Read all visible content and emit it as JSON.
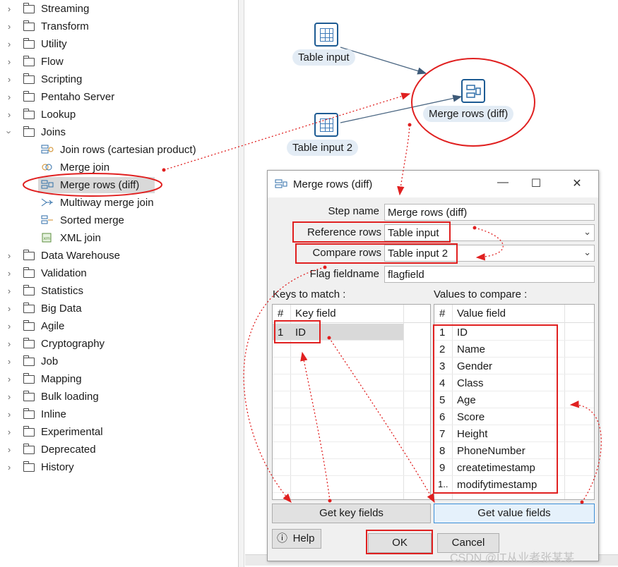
{
  "tree": {
    "categories_top": [
      {
        "label": "Streaming"
      },
      {
        "label": "Transform"
      },
      {
        "label": "Utility"
      },
      {
        "label": "Flow"
      },
      {
        "label": "Scripting"
      },
      {
        "label": "Pentaho Server"
      },
      {
        "label": "Lookup"
      }
    ],
    "joins": {
      "label": "Joins",
      "items": [
        {
          "label": "Join rows (cartesian product)"
        },
        {
          "label": "Merge join"
        },
        {
          "label": "Merge rows (diff)"
        },
        {
          "label": "Multiway merge join"
        },
        {
          "label": "Sorted merge"
        },
        {
          "label": "XML join"
        }
      ]
    },
    "categories_bottom": [
      {
        "label": "Data Warehouse"
      },
      {
        "label": "Validation"
      },
      {
        "label": "Statistics"
      },
      {
        "label": "Big Data"
      },
      {
        "label": "Agile"
      },
      {
        "label": "Cryptography"
      },
      {
        "label": "Job"
      },
      {
        "label": "Mapping"
      },
      {
        "label": "Bulk loading"
      },
      {
        "label": "Inline"
      },
      {
        "label": "Experimental"
      },
      {
        "label": "Deprecated"
      },
      {
        "label": "History"
      }
    ],
    "selected_item": "Merge rows (diff)"
  },
  "canvas": {
    "steps": {
      "table_input": "Table input",
      "table_input_2": "Table input 2",
      "merge_rows": "Merge rows (diff)"
    }
  },
  "dialog": {
    "title": "Merge rows (diff)",
    "step_name_label": "Step name",
    "step_name_value": "Merge rows (diff)",
    "reference_rows_label": "Reference rows",
    "reference_rows_value": "Table input",
    "compare_rows_label": "Compare rows",
    "compare_rows_value": "Table input 2",
    "flag_fieldname_label": "Flag fieldname",
    "flag_fieldname_value": "flagfield",
    "keys_title": "Keys to match :",
    "values_title": "Values to compare :",
    "keys_grid": {
      "col_num": "#",
      "col_field": "Key field",
      "rows": [
        {
          "num": "1",
          "field": "ID"
        }
      ]
    },
    "values_grid": {
      "col_num": "#",
      "col_field": "Value field",
      "rows": [
        {
          "num": "1",
          "field": "ID"
        },
        {
          "num": "2",
          "field": "Name"
        },
        {
          "num": "3",
          "field": "Gender"
        },
        {
          "num": "4",
          "field": "Class"
        },
        {
          "num": "5",
          "field": "Age"
        },
        {
          "num": "6",
          "field": "Score"
        },
        {
          "num": "7",
          "field": "Height"
        },
        {
          "num": "8",
          "field": "PhoneNumber"
        },
        {
          "num": "9",
          "field": "createtimestamp"
        },
        {
          "num": "1..",
          "field": "modifytimestamp"
        }
      ]
    },
    "get_key_fields": "Get key fields",
    "get_value_fields": "Get value fields",
    "help": "Help",
    "ok": "OK",
    "cancel": "Cancel"
  },
  "watermark": "CSDN @IT从业者张某某",
  "colors": {
    "annotation_red": "#e02020",
    "step_blue": "#1d5b93",
    "step_label_bg": "#e3ecf5"
  }
}
